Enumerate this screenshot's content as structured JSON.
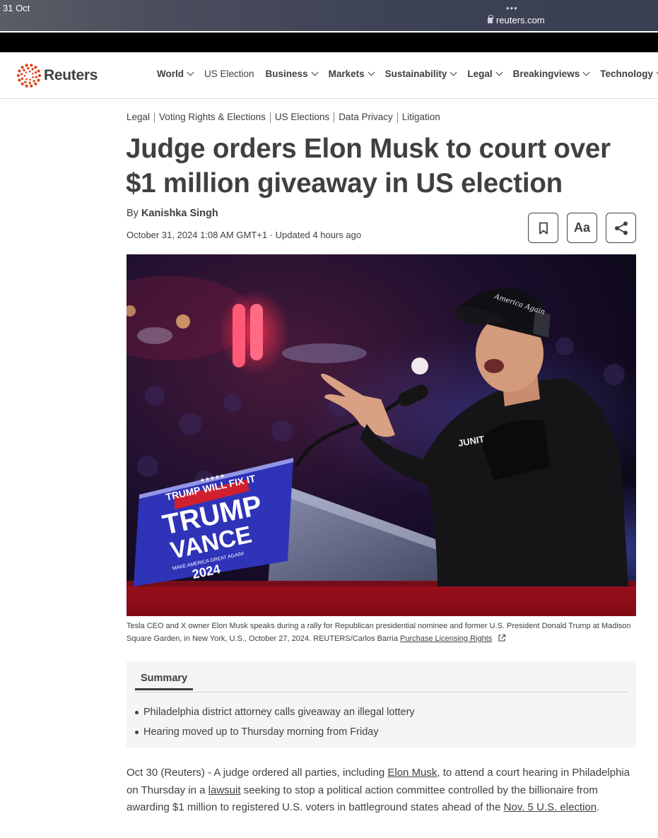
{
  "status_bar": {
    "date": "31 Oct",
    "dots": "•••",
    "url": "reuters.com"
  },
  "brand": {
    "name": "Reuters",
    "accent": "#e0421c"
  },
  "nav": {
    "items": [
      {
        "label": "World",
        "chevron": true
      },
      {
        "label": "US Election",
        "chevron": false
      },
      {
        "label": "Business",
        "chevron": true
      },
      {
        "label": "Markets",
        "chevron": true
      },
      {
        "label": "Sustainability",
        "chevron": true
      },
      {
        "label": "Legal",
        "chevron": true
      },
      {
        "label": "Breakingviews",
        "chevron": true
      },
      {
        "label": "Technology",
        "chevron": true
      }
    ]
  },
  "article": {
    "breadcrumbs": [
      "Legal",
      "Voting Rights & Elections",
      "US Elections",
      "Data Privacy",
      "Litigation"
    ],
    "headline": "Judge orders Elon Musk to court over $1 million giveaway in US election",
    "byline_prefix": "By ",
    "author": "Kanishka Singh",
    "dateline": "October 31, 2024 1:08 AM GMT+1 · Updated 4 hours ago",
    "tools": {
      "bookmark_icon": "bookmark-icon",
      "text_size_label": "Aa",
      "share_icon": "share-icon"
    },
    "image": {
      "sign_top": "★★★★★",
      "sign_banner": "TRUMP WILL FIX IT",
      "sign_line1": "TRUMP",
      "sign_line2": "VANCE",
      "sign_slogan": "MAKE AMERICA GREAT AGAIN!",
      "sign_year": "2024",
      "hat_text": "America Again",
      "shirt_text": "JUNIT"
    },
    "caption": "Tesla CEO and X owner Elon Musk speaks during a rally for Republican presidential nominee and former U.S. President Donald Trump at Madison Square Garden, in New York, U.S., October 27, 2024. REUTERS/Carlos Barria ",
    "caption_link": "Purchase Licensing Rights",
    "summary": {
      "tab_label": "Summary",
      "bullets": [
        "Philadelphia district attorney calls giveaway an illegal lottery",
        "Hearing moved up to Thursday morning from Friday"
      ]
    },
    "body": {
      "p1_a": "Oct 30 (Reuters) - A judge ordered all parties, including ",
      "link_musk": "Elon Musk",
      "p1_b": ", to attend a court hearing in Philadelphia on Thursday in a ",
      "link_lawsuit": "lawsuit",
      "p1_c": " seeking to stop a political action committee controlled by the billionaire from awarding $1 million to registered U.S. voters in battleground states ahead of the ",
      "link_election": "Nov. 5 U.S. election",
      "p1_d": "."
    }
  }
}
